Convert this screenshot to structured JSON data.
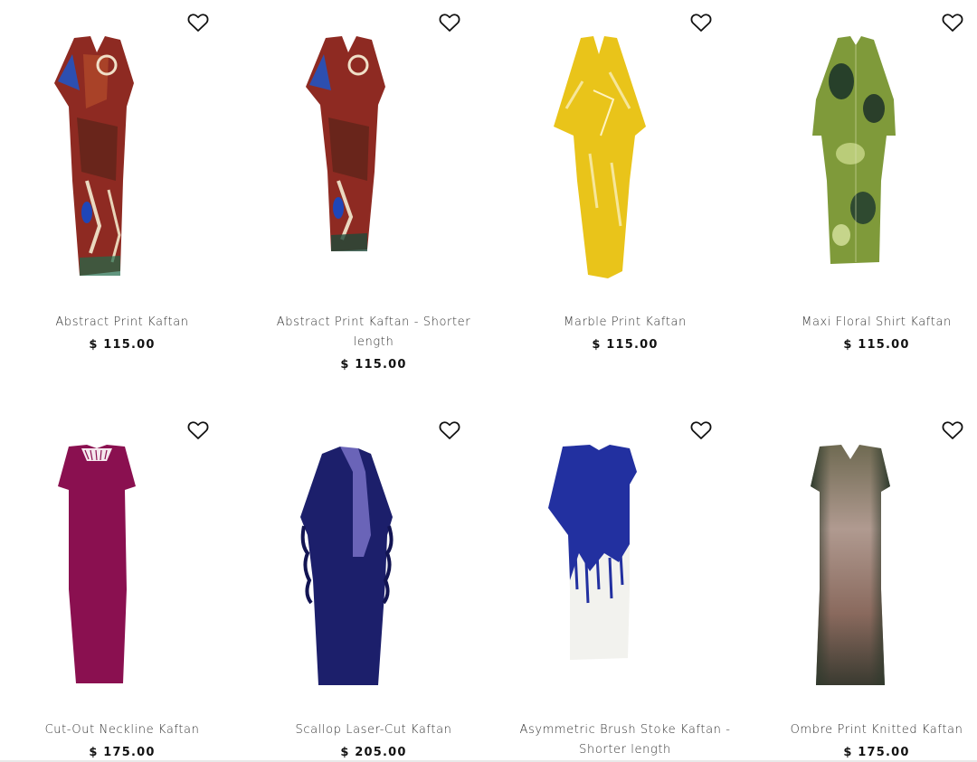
{
  "products": [
    {
      "name": "Abstract Print Kaftan",
      "price": "$ 115.00",
      "wishlist_icon": "heart-outline-icon"
    },
    {
      "name": "Abstract Print Kaftan - Shorter length",
      "price": "$ 115.00",
      "wishlist_icon": "heart-outline-icon"
    },
    {
      "name": "Marble Print Kaftan",
      "price": "$ 115.00",
      "wishlist_icon": "heart-outline-icon"
    },
    {
      "name": "Maxi Floral Shirt Kaftan",
      "price": "$ 115.00",
      "wishlist_icon": "heart-outline-icon"
    },
    {
      "name": "Cut-Out Neckline Kaftan",
      "price": "$ 175.00",
      "wishlist_icon": "heart-outline-icon"
    },
    {
      "name": "Scallop Laser-Cut Kaftan",
      "price": "$ 205.00",
      "wishlist_icon": "heart-outline-icon"
    },
    {
      "name": "Asymmetric Brush Stoke Kaftan - Shorter length",
      "price": "",
      "wishlist_icon": "heart-outline-icon"
    },
    {
      "name": "Ombre Print Knitted Kaftan",
      "price": "$ 175.00",
      "wishlist_icon": "heart-outline-icon"
    }
  ],
  "colors": {
    "abstract_red": "#8e2a22",
    "marble_yellow": "#e9c41a",
    "floral_green": "#7f9a3a",
    "magenta": "#8a1050",
    "navy": "#1c1f6b",
    "cobalt": "#2230a0",
    "ombre_brown": "#8a6a5e"
  }
}
